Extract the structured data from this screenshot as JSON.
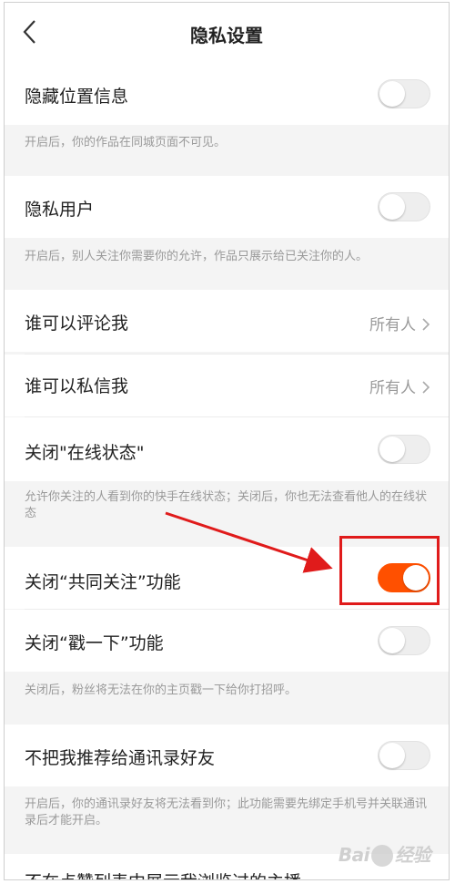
{
  "header": {
    "title": "隐私设置"
  },
  "settings": {
    "hide_location": {
      "label": "隐藏位置信息",
      "on": false,
      "note": "开启后，你的作品在同城页面不可见。"
    },
    "private_user": {
      "label": "隐私用户",
      "on": false,
      "note": "开启后，别人关注你需要你的允许，作品只展示给已关注你的人。"
    },
    "who_comment": {
      "label": "谁可以评论我",
      "value": "所有人"
    },
    "who_message": {
      "label": "谁可以私信我",
      "value": "所有人"
    },
    "online_status": {
      "label": "关闭\"在线状态\"",
      "on": false,
      "note": "允许你关注的人看到你的快手在线状态；关闭后，你也无法查看他人的在线状态"
    },
    "mutual_follow": {
      "label": "关闭“共同关注”功能",
      "on": true
    },
    "poke": {
      "label": "关闭“戳一下”功能",
      "on": false,
      "note": "关闭后，粉丝将无法在你的主页戳一下给你打招呼。"
    },
    "contacts": {
      "label": "不把我推荐给通讯录好友",
      "on": false,
      "note": "开启后，你的通讯录好友将无法看到你；此功能需要先绑定手机号并关联通讯录后才能开启。"
    },
    "partial_row": {
      "label": "不在点赞列表中展示我浏览过的主播"
    }
  },
  "watermark": {
    "text": "Bai经验"
  },
  "colors": {
    "accent": "#ff5000",
    "highlight": "#e01b1b"
  }
}
